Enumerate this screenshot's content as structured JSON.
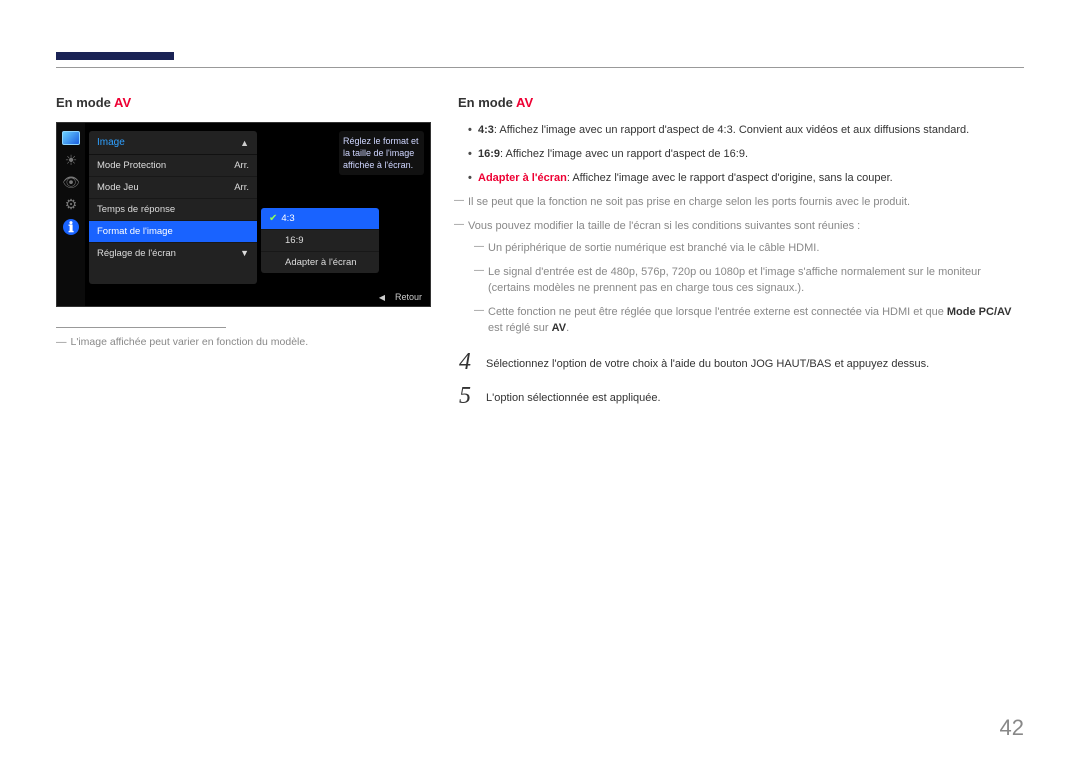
{
  "heading": {
    "text_prefix": "En mode ",
    "av": "AV"
  },
  "osd": {
    "title": "Image",
    "tooltip": "Réglez le format et la taille de l'image affichée à l'écran.",
    "menu": [
      {
        "label": "Mode Protection",
        "value": "Arr."
      },
      {
        "label": "Mode Jeu",
        "value": "Arr."
      },
      {
        "label": "Temps de réponse",
        "value": ""
      },
      {
        "label": "Format de l'image",
        "value": ""
      },
      {
        "label": "Réglage de l'écran",
        "value": ""
      }
    ],
    "submenu": [
      "4:3",
      "16:9",
      "Adapter à l'écran"
    ],
    "footer": {
      "back": "Retour"
    },
    "icons": {
      "monitor": "monitor-icon",
      "sun": "☀",
      "eye": "👁",
      "gear": "⚙",
      "info": "ℹ",
      "up": "▲",
      "down": "▼",
      "left": "◀",
      "check": "✔"
    }
  },
  "caption": {
    "dash": "―",
    "text": "L'image affichée peut varier en fonction du modèle."
  },
  "bullets": [
    {
      "label": "4:3",
      "text": ": Affichez l'image avec un rapport d'aspect de 4:3. Convient aux vidéos et aux diffusions standard."
    },
    {
      "label": "16:9",
      "text": ": Affichez l'image avec un rapport d'aspect de 16:9."
    },
    {
      "label": "Adapter à l'écran",
      "label_red": true,
      "text": ": Affichez l'image avec le rapport d'aspect d'origine, sans la couper."
    }
  ],
  "dashes": {
    "line1": "Il se peut que la fonction ne soit pas prise en charge selon les ports fournis avec le produit.",
    "line2": "Vous pouvez modifier la taille de l'écran si les conditions suivantes sont réunies :",
    "inner1": "Un périphérique de sortie numérique est branché via le câble HDMI.",
    "inner2": "Le signal d'entrée est de 480p, 576p, 720p ou 1080p et l'image s'affiche normalement sur le moniteur (certains modèles ne prennent pas en charge tous ces signaux.).",
    "inner3_a": "Cette fonction ne peut être réglée que lorsque l'entrée externe est connectée via HDMI et que ",
    "inner3_b": "Mode PC/AV",
    "inner3_c": " est réglé sur ",
    "inner3_d": "AV",
    "inner3_e": "."
  },
  "steps": [
    {
      "num": "4",
      "text": "Sélectionnez l'option de votre choix à l'aide du bouton JOG HAUT/BAS et appuyez dessus."
    },
    {
      "num": "5",
      "text": "L'option sélectionnée est appliquée."
    }
  ],
  "pageNum": "42"
}
